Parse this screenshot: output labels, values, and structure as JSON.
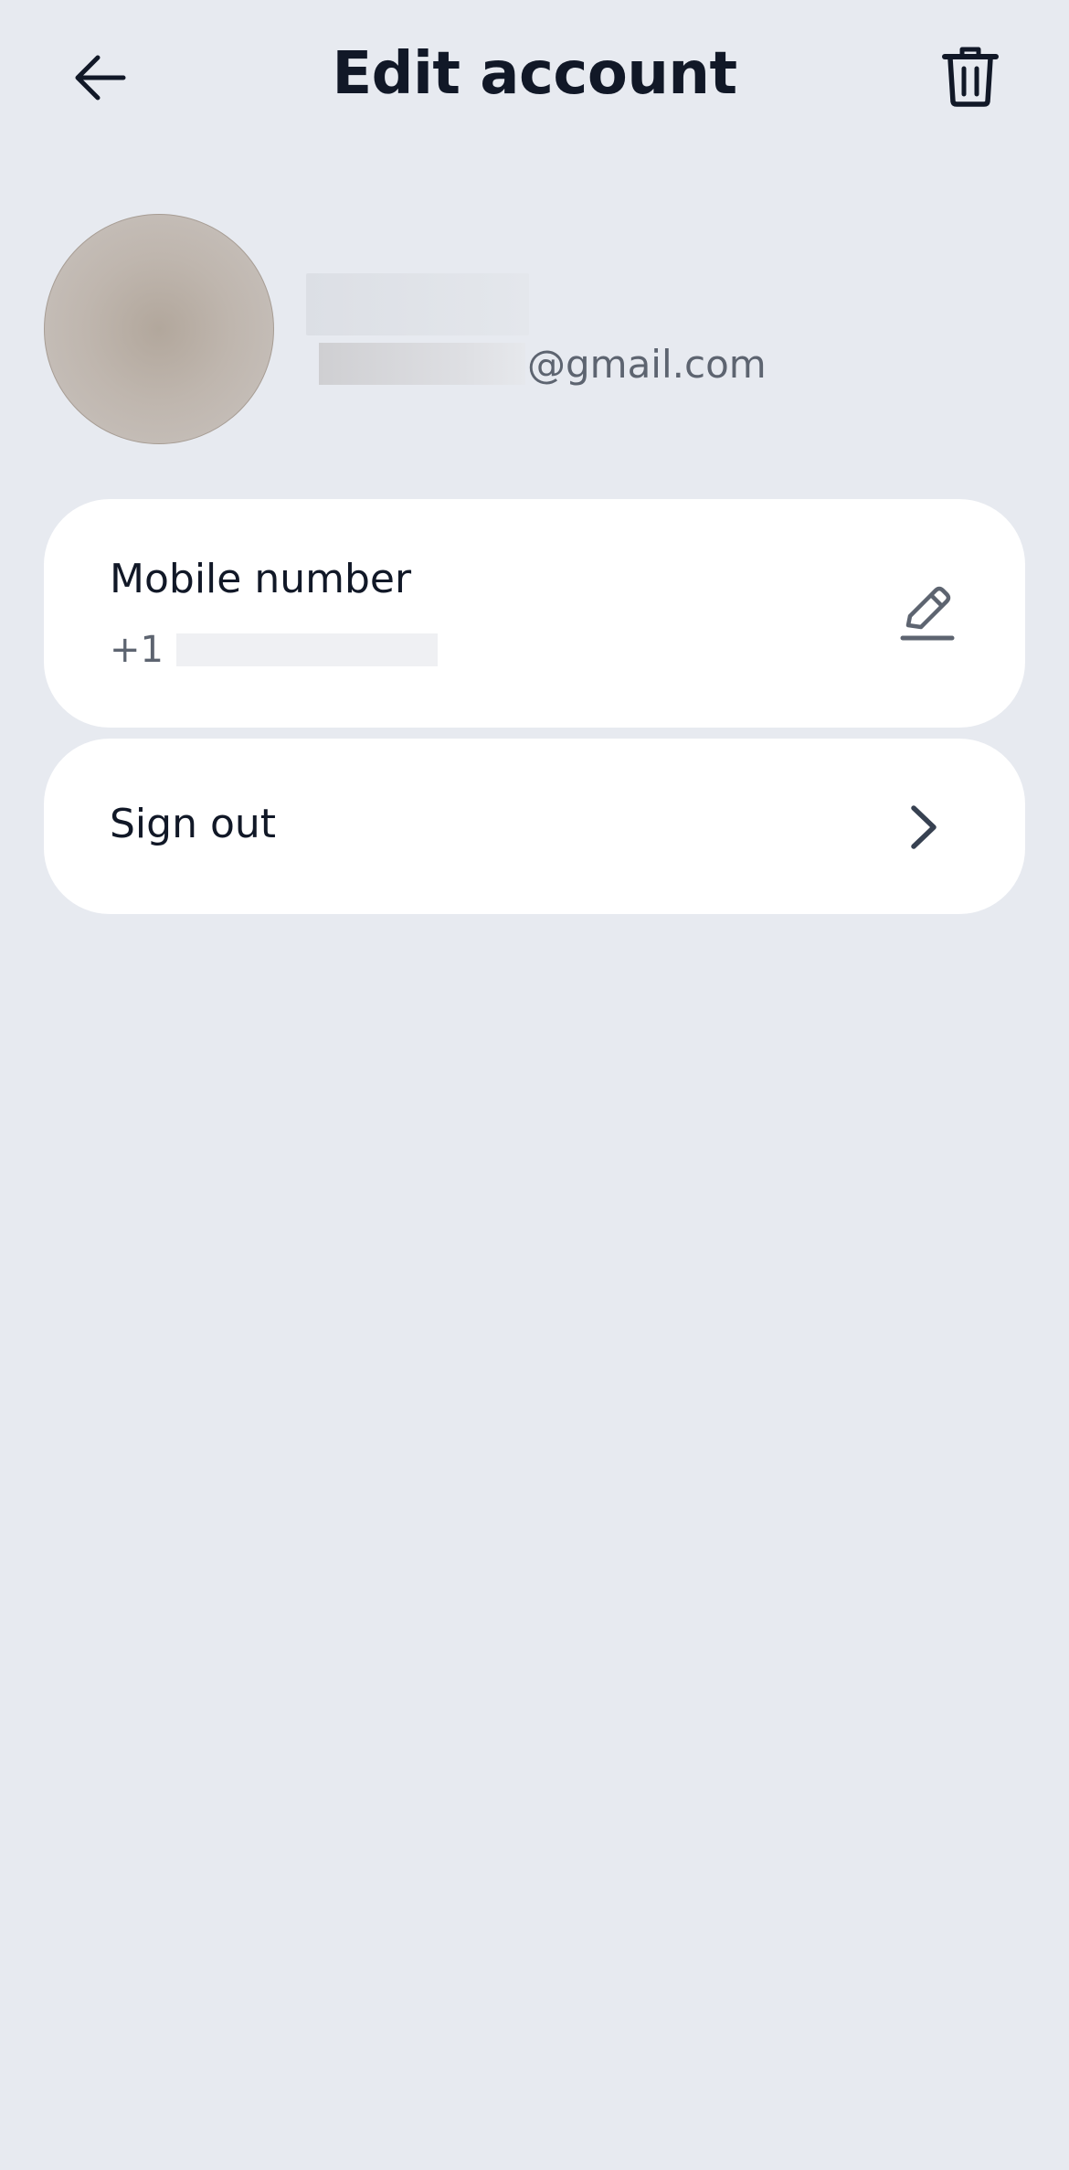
{
  "header": {
    "title": "Edit account",
    "back_icon": "arrow-left-icon",
    "delete_icon": "trash-icon"
  },
  "profile": {
    "name": "",
    "email_domain": "@gmail.com"
  },
  "mobile_card": {
    "label": "Mobile number",
    "country_code": "+1",
    "edit_icon": "pencil-icon"
  },
  "signout_card": {
    "label": "Sign out",
    "chevron_icon": "chevron-right-icon"
  },
  "colors": {
    "background": "#e7eaf0",
    "card": "#ffffff",
    "text_primary": "#111827",
    "text_secondary": "#5d6470"
  }
}
